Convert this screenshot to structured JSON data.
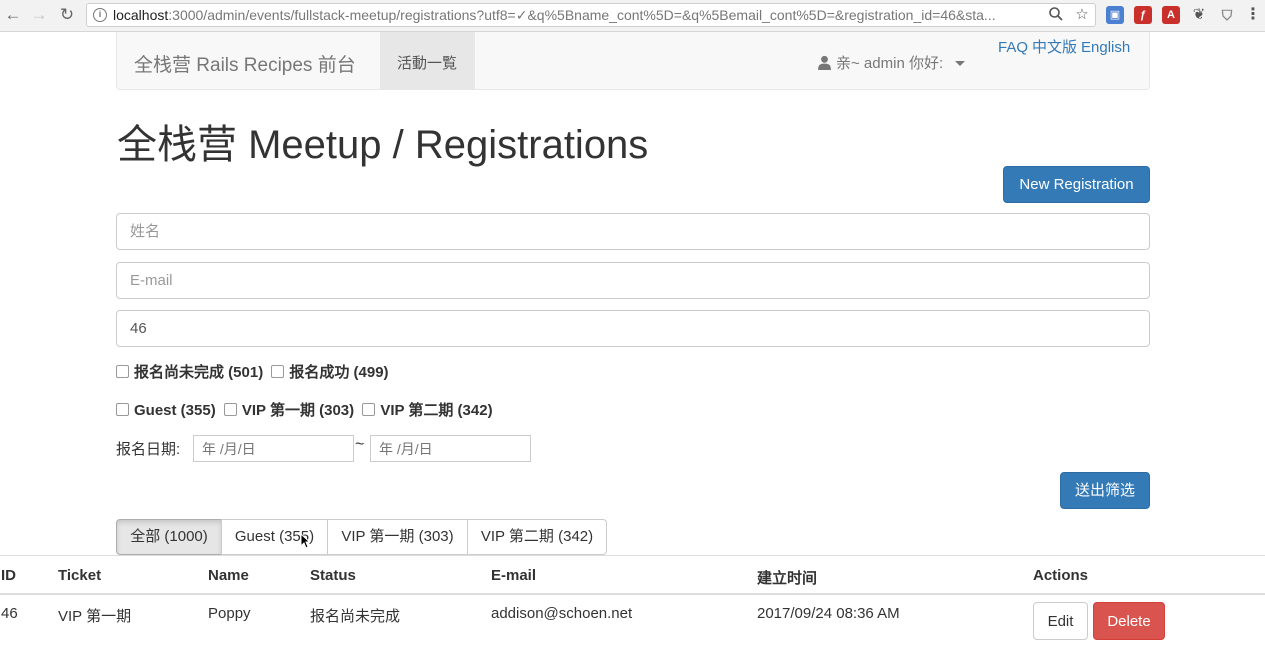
{
  "browser": {
    "url_host": "localhost",
    "url_rest": ":3000/admin/events/fullstack-meetup/registrations?utf8=✓&q%5Bname_cont%5D=&q%5Bemail_cont%5D=&registration_id=46&sta...",
    "info_glyph": "i"
  },
  "navbar": {
    "brand": "全栈营 Rails Recipes 前台",
    "active_item": "活動一覧",
    "user_greeting": "亲~ admin 你好:",
    "lang_faq": "FAQ",
    "lang_zh": "中文版",
    "lang_en": "English"
  },
  "page": {
    "title": "全栈营 Meetup / Registrations",
    "new_button": "New Registration"
  },
  "filters": {
    "name_placeholder": "姓名",
    "email_placeholder": "E-mail",
    "registration_id_value": "46",
    "status_options": [
      "报名尚未完成 (501)",
      "报名成功 (499)"
    ],
    "ticket_options": [
      "Guest (355)",
      "VIP 第一期 (303)",
      "VIP 第二期 (342)"
    ],
    "date_label": "报名日期:",
    "date_from_placeholder": "年 /月/日",
    "date_to_placeholder": "年 /月/日",
    "date_separator": "~",
    "submit_label": "送出筛选"
  },
  "tabs": [
    "全部 (1000)",
    "Guest (355)",
    "VIP 第一期 (303)",
    "VIP 第二期 (342)"
  ],
  "table": {
    "headers": [
      "ID",
      "Ticket",
      "Name",
      "Status",
      "E-mail",
      "建立时间",
      "Actions"
    ],
    "rows": [
      {
        "id": "46",
        "ticket": "VIP 第一期",
        "name": "Poppy",
        "status": "报名尚未完成",
        "email": "addison@schoen.net",
        "created_at": "2017/09/24 08:36 AM",
        "edit_label": "Edit",
        "delete_label": "Delete"
      }
    ]
  },
  "colors": {
    "primary": "#337ab7",
    "danger": "#d9534f",
    "link": "#337ab7"
  }
}
